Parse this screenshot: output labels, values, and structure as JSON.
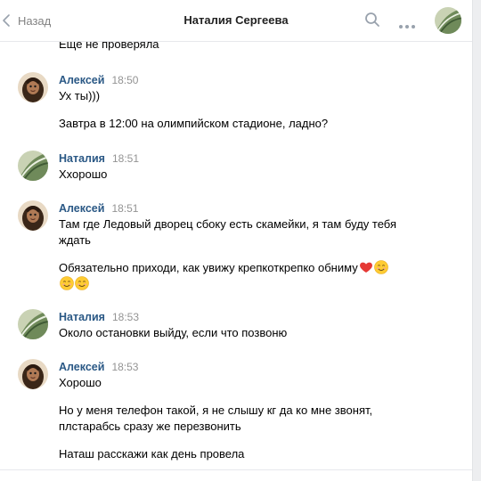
{
  "header": {
    "back_label": "Назад",
    "title": "Наталия Сергеева"
  },
  "first_text": "Еще не проверяла",
  "messages": [
    {
      "author": "Алексей",
      "time": "18:50",
      "avatar": "alexey",
      "lines": [
        "Ух ты)))",
        "",
        "Завтра в 12:00 на олимпийском стадионе, ладно?"
      ]
    },
    {
      "author": "Наталия",
      "time": "18:51",
      "avatar": "natalia",
      "lines": [
        "Ххорошо"
      ]
    },
    {
      "author": "Алексей",
      "time": "18:51",
      "avatar": "alexey",
      "lines": [
        "Там где Ледовый дворец сбоку есть скамейки, я там буду тебя",
        "ждать",
        "",
        "Обязательно приходи, как увижу крепкоткрепко обниму"
      ]
    },
    {
      "author": "Наталия",
      "time": "18:53",
      "avatar": "natalia",
      "lines": [
        "Около остановки выйду, если что позвоню"
      ]
    },
    {
      "author": "Алексей",
      "time": "18:53",
      "avatar": "alexey",
      "lines": [
        "Хорошо",
        "",
        "Но у меня телефон такой, я не слышу кг да ко мне звонят,",
        "плстарабсь сразу же перезвонить",
        "",
        "Наташ расскажи как день провела"
      ]
    }
  ],
  "icons": {
    "back": "chevron-left-icon",
    "search": "search-icon",
    "more": "more-horizontal-icon",
    "heart": "red-heart-emoji",
    "smile": "smiling-face-emoji"
  },
  "colors": {
    "author_name": "#2a5885",
    "timestamp": "#939393",
    "back_text": "#828282",
    "divider": "#e7e8ec"
  }
}
